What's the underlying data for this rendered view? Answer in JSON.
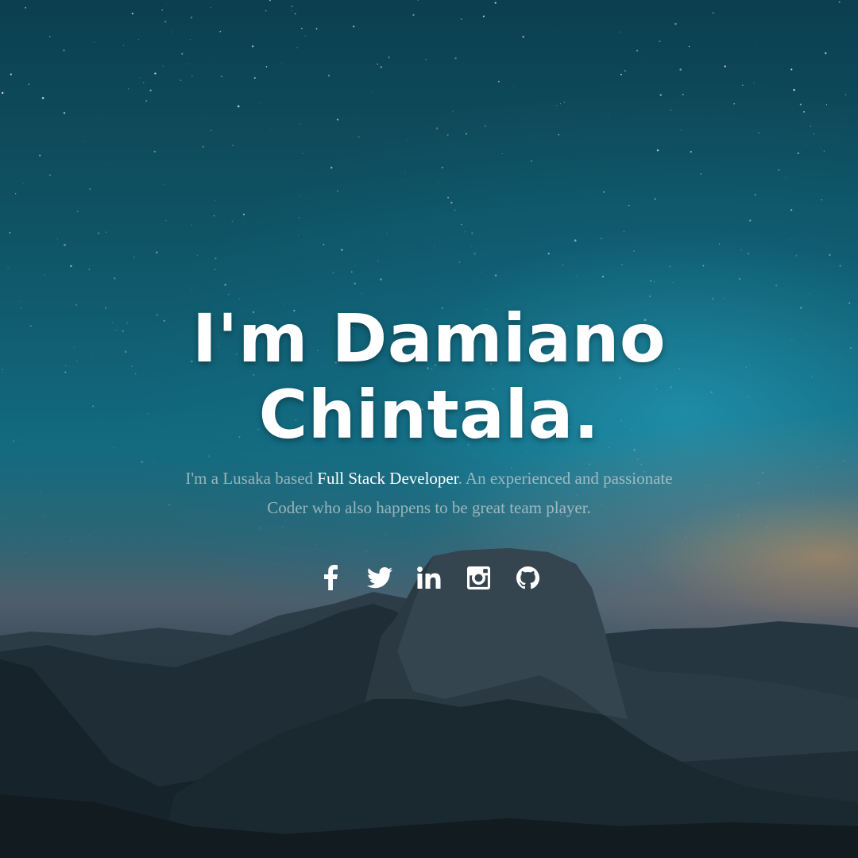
{
  "hero": {
    "headline_line1": "I'm Damiano",
    "headline_line2": "Chintala.",
    "intro_prefix": "I'm a Lusaka based ",
    "intro_highlight": "Full Stack Developer",
    "intro_suffix": ". An experienced and passionate Coder who also happens to be great team player."
  },
  "social": [
    {
      "icon": "facebook-icon"
    },
    {
      "icon": "twitter-icon"
    },
    {
      "icon": "linkedin-icon"
    },
    {
      "icon": "instagram-icon"
    },
    {
      "icon": "github-icon"
    }
  ],
  "colors": {
    "text_primary": "#ffffff",
    "text_muted": "#c8c8c8",
    "sky_top": "#0c3f4f",
    "sky_glow": "#28aac8",
    "horizon_warm": "#e6965a"
  }
}
